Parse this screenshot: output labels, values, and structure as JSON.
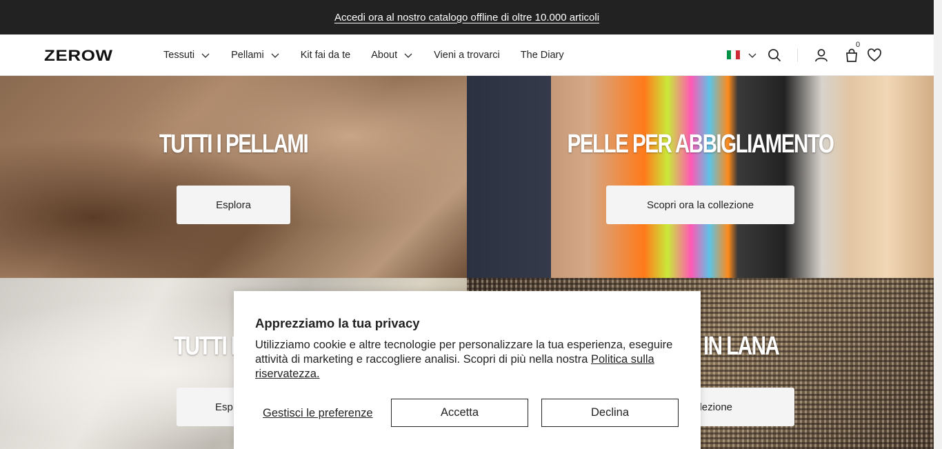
{
  "announcement": {
    "text": "Accedi ora al nostro catalogo offline di oltre 10.000 articoli"
  },
  "header": {
    "logo": "ZEROW",
    "nav": [
      {
        "label": "Tessuti",
        "dropdown": true
      },
      {
        "label": "Pellami",
        "dropdown": true
      },
      {
        "label": "Kit fai da te",
        "dropdown": false
      },
      {
        "label": "About",
        "dropdown": true
      },
      {
        "label": "Vieni a trovarci",
        "dropdown": false
      },
      {
        "label": "The Diary",
        "dropdown": false
      }
    ],
    "cart_count": "0",
    "icons": [
      "italy-flag-icon",
      "search-icon",
      "account-icon",
      "cart-icon",
      "wishlist-heart-icon"
    ]
  },
  "tiles": [
    {
      "title": "TUTTI I PELLAMI",
      "cta": "Esplora"
    },
    {
      "title": "PELLE PER ABBIGLIAMENTO",
      "cta": "Scopri ora la collezione"
    },
    {
      "title": "TUTTI I T",
      "cta": "Esp"
    },
    {
      "title": "IN LANA",
      "cta": "a collezione"
    }
  ],
  "cookie": {
    "title": "Apprezziamo la tua privacy",
    "message": "Utilizziamo cookie e altre tecnologie per personalizzare la tua esperienza, eseguire attività di marketing e raccogliere analisi. Scopri di più nella nostra ",
    "policy_link": "Politica sulla riservatezza.",
    "manage": "Gestisci le preferenze",
    "accept": "Accetta",
    "decline": "Declina"
  },
  "colors": {
    "announcement_bg": "#222222",
    "cta_bg": "#f4f4f4",
    "flag_green": "#009246",
    "flag_red": "#ce2b37"
  }
}
